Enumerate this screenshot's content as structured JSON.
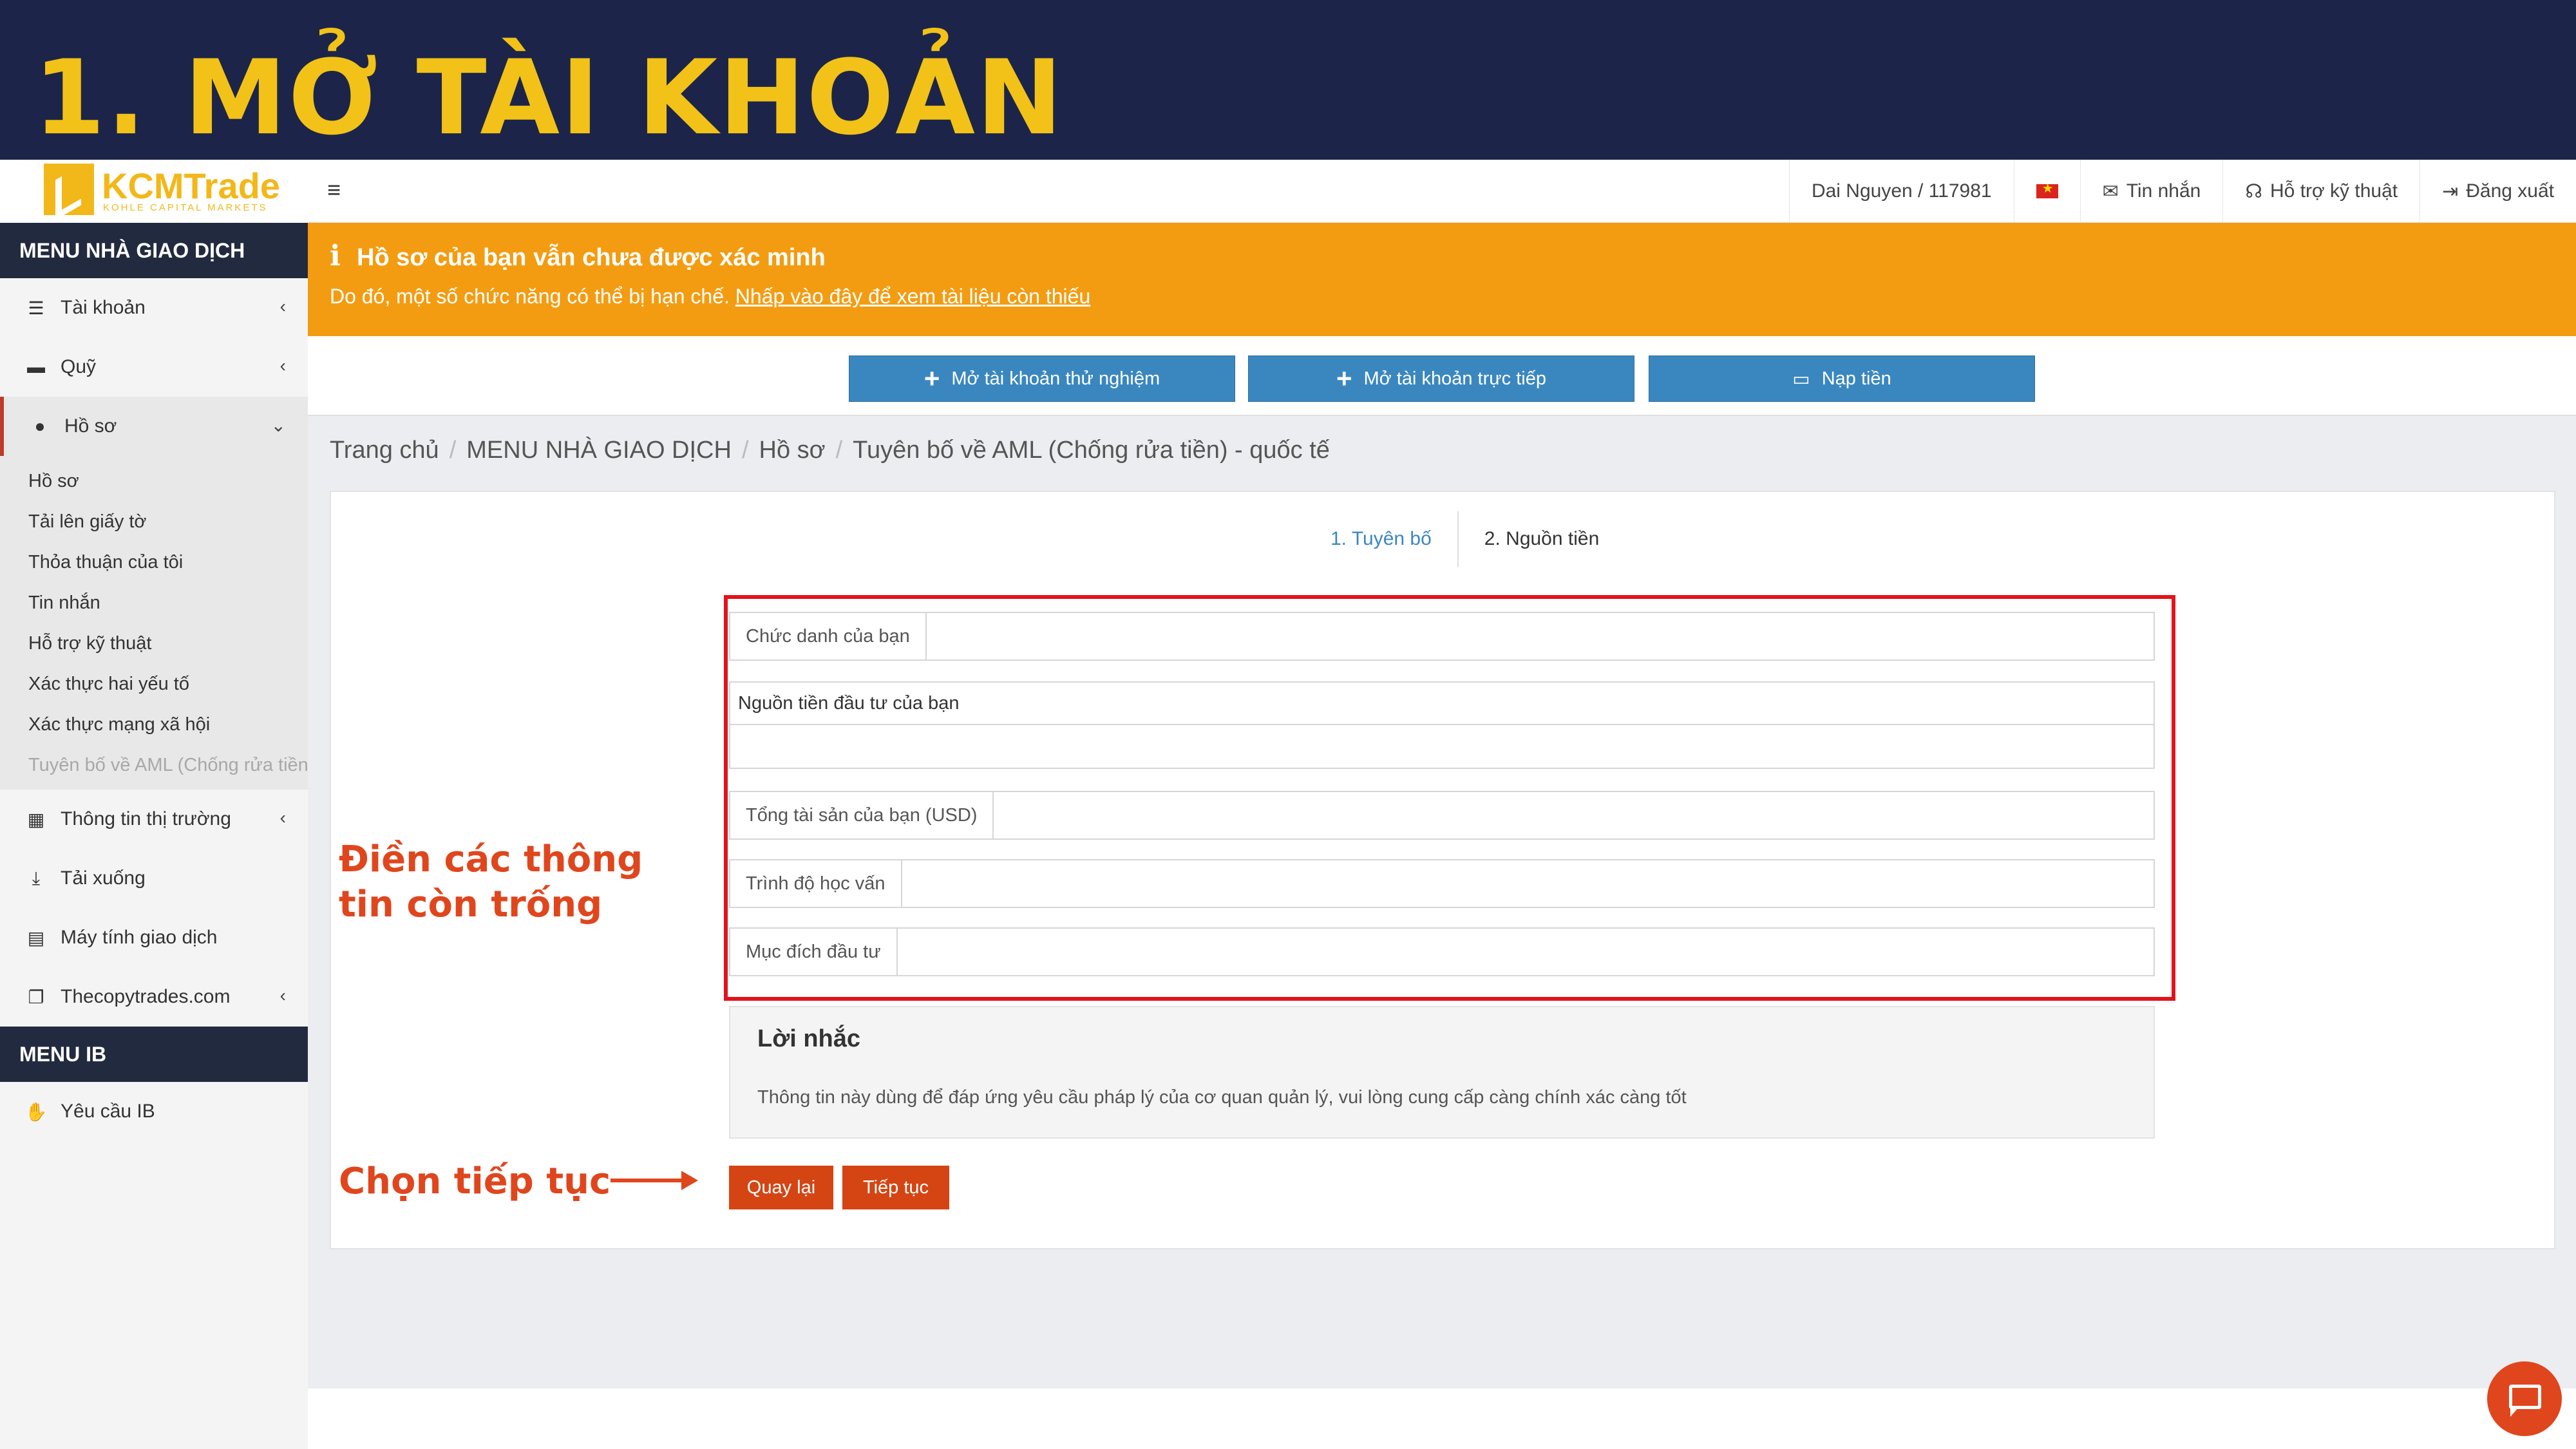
{
  "banner": {
    "title": "1. MỞ TÀI KHOẢN"
  },
  "logo": {
    "name": "KCMTrade",
    "tagline": "KOHLE CAPITAL MARKETS"
  },
  "topnav": {
    "user": "Dai Nguyen / 117981",
    "messages": "Tin nhắn",
    "support": "Hỗ trợ kỹ thuật",
    "logout": "Đăng xuất"
  },
  "sidebar": {
    "header": "MENU NHÀ GIAO DỊCH",
    "items": [
      {
        "label": "Tài khoản",
        "icon": "list-icon"
      },
      {
        "label": "Quỹ",
        "icon": "wallet-icon"
      },
      {
        "label": "Hồ sơ",
        "icon": "user-icon"
      }
    ],
    "profile_sub": [
      "Hồ sơ",
      "Tải lên giấy tờ",
      "Thỏa thuận của tôi",
      "Tin nhắn",
      "Hỗ trợ kỹ thuật",
      "Xác thực hai yếu tố",
      "Xác thực mạng xã hội",
      "Tuyên bố về AML (Chống rửa tiền) - quốc tế"
    ],
    "items2": [
      {
        "label": "Thông tin thị trường",
        "icon": "calendar-icon"
      },
      {
        "label": "Tải xuống",
        "icon": "download-icon"
      },
      {
        "label": "Máy tính giao dịch",
        "icon": "calculator-icon"
      },
      {
        "label": "Thecopytrades.com",
        "icon": "copy-icon"
      }
    ],
    "ib_header": "MENU IB",
    "ib_items": [
      {
        "label": "Yêu cầu IB",
        "icon": "handshake-icon"
      }
    ]
  },
  "alert": {
    "title": "Hồ sơ của bạn vẫn chưa được xác minh",
    "text": "Do đó, một số chức năng có thể bị hạn chế.",
    "link": "Nhấp vào đây để xem tài liệu còn thiếu"
  },
  "actions": {
    "demo": "Mở tài khoản thử nghiệm",
    "live": "Mở tài khoản trực tiếp",
    "deposit": "Nạp tiền"
  },
  "breadcrumb": [
    "Trang chủ",
    "MENU NHÀ GIAO DỊCH",
    "Hồ sơ",
    "Tuyên bố về AML (Chống rửa tiền) - quốc tế"
  ],
  "steps": [
    "1. Tuyên bố",
    "2. Nguồn tiền"
  ],
  "form": {
    "job_title": {
      "label": "Chức danh của bạn",
      "value": ""
    },
    "source_of_funds": {
      "label": "Nguồn tiền đầu tư của bạn",
      "value": ""
    },
    "total_assets": {
      "label": "Tổng tài sản của bạn (USD)",
      "value": ""
    },
    "education": {
      "label": "Trình độ học vấn",
      "value": ""
    },
    "purpose": {
      "label": "Mục đích đầu tư",
      "value": ""
    }
  },
  "reminder": {
    "title": "Lời nhắc",
    "text": "Thông tin này dùng để đáp ứng yêu cầu pháp lý của cơ quan quản lý, vui lòng cung cấp càng chính xác càng tốt"
  },
  "buttons": {
    "back": "Quay lại",
    "next": "Tiếp tục"
  },
  "annotations": {
    "fill_line1": "Điền các thông",
    "fill_line2": "tin còn trống",
    "continue": "Chọn tiếp tục"
  },
  "colors": {
    "banner": "#1c2549",
    "title": "#f2c218",
    "alert": "#f39c12",
    "primary": "#3a87c0",
    "action": "#d44513",
    "highlight": "#e3131b"
  }
}
